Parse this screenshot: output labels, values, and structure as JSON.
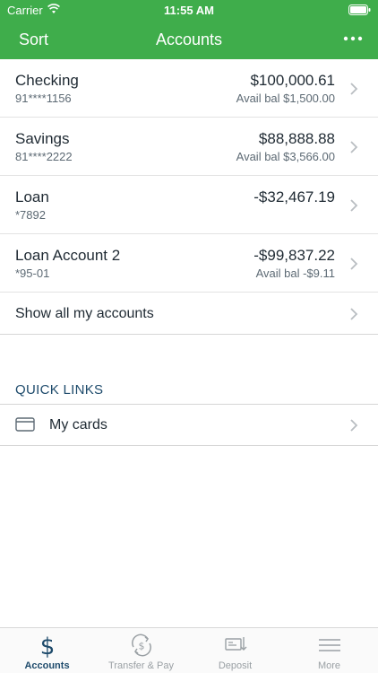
{
  "status_bar": {
    "carrier": "Carrier",
    "time": "11:55 AM"
  },
  "nav": {
    "sort_label": "Sort",
    "title": "Accounts"
  },
  "accounts": [
    {
      "name": "Checking",
      "number": "91****1156",
      "amount": "$100,000.61",
      "avail": "Avail bal $1,500.00"
    },
    {
      "name": "Savings",
      "number": "81****2222",
      "amount": "$88,888.88",
      "avail": "Avail bal $3,566.00"
    },
    {
      "name": "Loan",
      "number": "*7892",
      "amount": "-$32,467.19",
      "avail": ""
    },
    {
      "name": "Loan Account 2",
      "number": "*95-01",
      "amount": "-$99,837.22",
      "avail": "Avail bal -$9.11"
    }
  ],
  "show_all_label": "Show all my accounts",
  "quick_links": {
    "header": "QUICK LINKS",
    "items": [
      {
        "label": "My cards",
        "icon": "credit-card-icon"
      }
    ]
  },
  "tabs": [
    {
      "label": "Accounts",
      "icon": "dollar-icon",
      "active": true
    },
    {
      "label": "Transfer & Pay",
      "icon": "transfer-icon",
      "active": false
    },
    {
      "label": "Deposit",
      "icon": "deposit-icon",
      "active": false
    },
    {
      "label": "More",
      "icon": "menu-icon",
      "active": false
    }
  ],
  "colors": {
    "brand_green": "#3fad4b",
    "active_tab": "#1d4a6b",
    "inactive_tab": "#9aa0a4"
  }
}
